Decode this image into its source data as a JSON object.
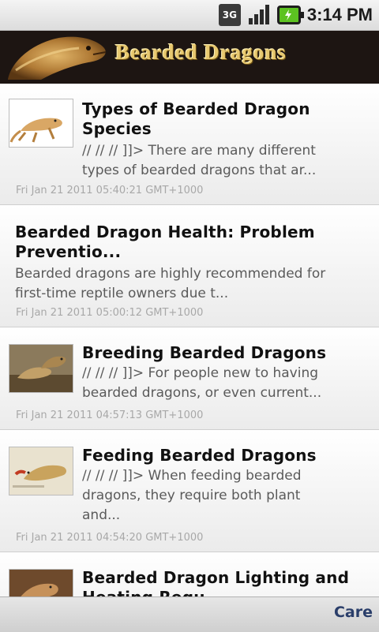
{
  "status_bar": {
    "network_label": "3G",
    "time": "3:14 PM",
    "icons": [
      "3g-icon",
      "signal-icon",
      "battery-charging-icon"
    ]
  },
  "banner": {
    "title": "Bearded Dragons"
  },
  "feed": {
    "items": [
      {
        "title_line1": "Types of Bearded Dragon",
        "title_line2": "Species",
        "desc_line1": "// // // ]]> There are many different",
        "desc_line2": "types of bearded dragons that ar...",
        "date": "Fri Jan 21 2011 05:40:21 GMT+1000",
        "has_thumb": true
      },
      {
        "title_line1": "Bearded Dragon Health: Problem",
        "title_line2": "Preventio...",
        "desc_line1": "Bearded dragons are highly recommended for",
        "desc_line2": "first-time reptile owners due t...",
        "date": "Fri Jan 21 2011 05:00:12 GMT+1000",
        "has_thumb": false
      },
      {
        "title_line1": "Breeding Bearded Dragons",
        "desc_line1": "// // // ]]> For people new to having",
        "desc_line2": "bearded dragons, or even current...",
        "date": "Fri Jan 21 2011 04:57:13 GMT+1000",
        "has_thumb": true
      },
      {
        "title_line1": "Feeding Bearded Dragons",
        "desc_line1": "// // // ]]> When feeding bearded",
        "desc_line2": "dragons, they require both plant",
        "desc_line3": "and...",
        "date": "Fri Jan 21 2011 04:54:20 GMT+1000",
        "has_thumb": true
      },
      {
        "title_line1": "Bearded Dragon Lighting and",
        "title_line2": "Heating Regu...",
        "has_thumb": true
      }
    ]
  },
  "bottom_bar": {
    "tab_label": "Care"
  },
  "colors": {
    "banner_bg": "#1d1512",
    "banner_text": "#e8c970",
    "battery_green": "#5cc221",
    "tab_text": "#2a3e6a"
  }
}
